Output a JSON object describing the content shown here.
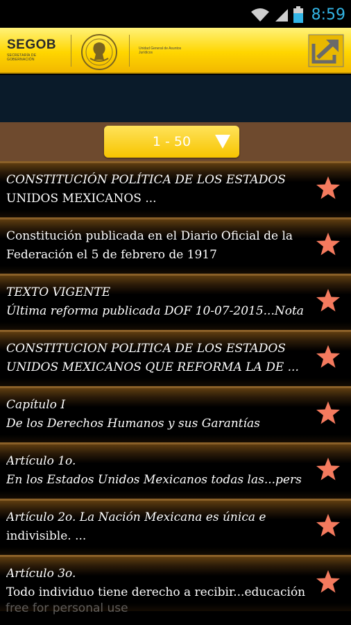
{
  "status_bar": {
    "time": "8:59",
    "icons": [
      "wifi-icon",
      "signal-icon",
      "battery-icon"
    ]
  },
  "header": {
    "brand": "SEGOB",
    "brand_sub": "SECRETARÍA DE GOBERNACIÓN",
    "unit": "Unidad General de Asuntos Jurídicos",
    "share_icon": "share-external-icon"
  },
  "range_select": {
    "value": "1 - 50"
  },
  "list": [
    {
      "line1": "CONSTITUCIÓN POLÍTICA DE LOS ESTADOS",
      "line2": "UNIDOS MEXICANOS ...",
      "italic1": true,
      "italic2": false
    },
    {
      "line1": "Constitución publicada en el Diario Oficial de la",
      "line2": "Federación el 5 de febrero de 1917",
      "italic1": false,
      "italic2": false
    },
    {
      "line1": "TEXTO VIGENTE",
      "line2": "Última reforma publicada DOF 10-07-2015...Nota",
      "italic1": true,
      "italic2": true
    },
    {
      "line1": "CONSTITUCION POLITICA DE LOS ESTADOS",
      "line2": "UNIDOS MEXICANOS QUE REFORMA LA DE ...",
      "italic1": true,
      "italic2": true
    },
    {
      "line1": "Capítulo I",
      "line2": "De los Derechos Humanos y sus Garantías",
      "italic1": true,
      "italic2": true
    },
    {
      "line1": "Artículo 1o.",
      "line2": "En los Estados Unidos Mexicanos todas las...pers",
      "italic1": true,
      "italic2": true
    },
    {
      "line1": "Artículo 2o. La Nación Mexicana es única e",
      "line2": "indivisible. ...",
      "italic1": true,
      "italic2": false
    },
    {
      "line1": "Artículo 3o.",
      "line2": "Todo individuo tiene derecho a recibir...educación",
      "italic1": true,
      "italic2": false
    }
  ],
  "watermark": "free for personal use",
  "colors": {
    "header_yellow": "#ffd600",
    "banner_navy": "#0a1b2a",
    "band_brown": "#6e4a2e",
    "star_salmon": "#f47a5e",
    "clock_blue": "#33b5e5"
  }
}
